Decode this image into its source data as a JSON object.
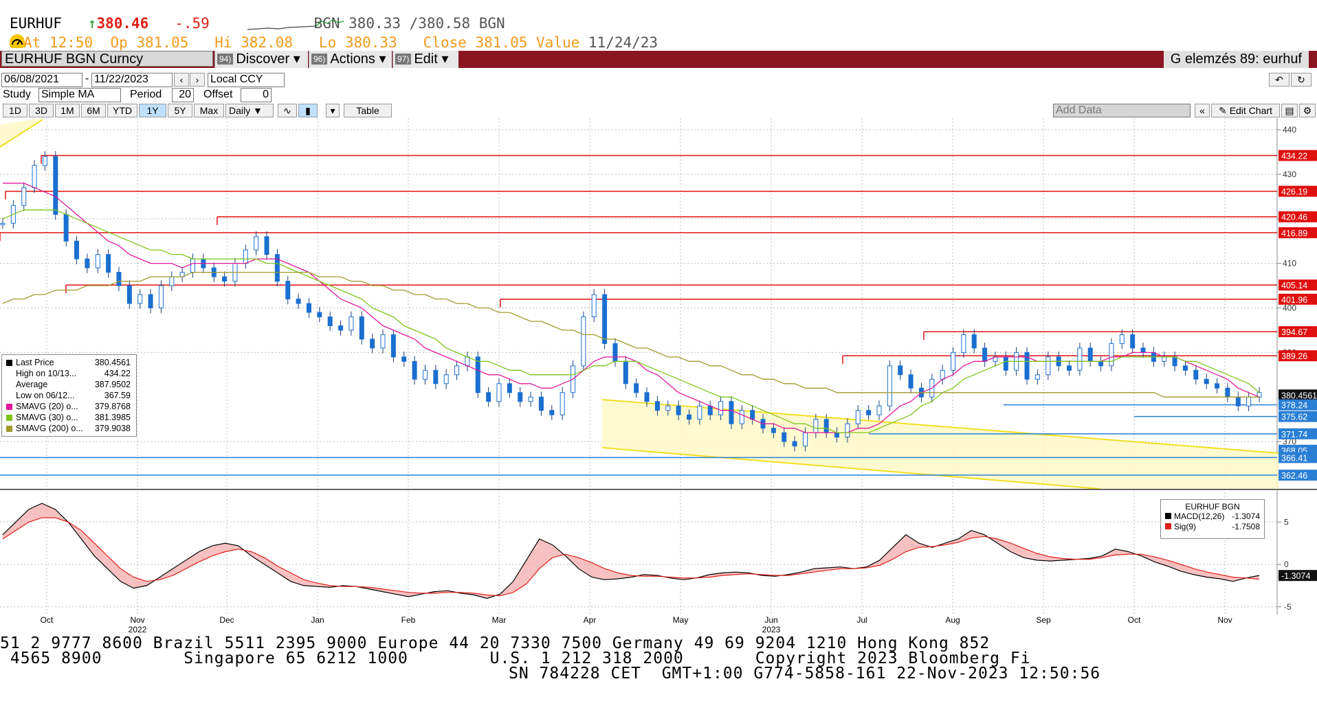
{
  "quote": {
    "ticker": "EURHUF",
    "arrow": "↑",
    "last": "380.46",
    "change": "-.59",
    "bid_ask": "BGN 380.33 /380.58 BGN",
    "at": "At 12:50",
    "open": "Op 381.05",
    "hi": "Hi 382.08",
    "lo": "Lo 380.33",
    "close_label": "Close 381.05",
    "value_label": "Value",
    "value_date": "11/24/23"
  },
  "toolbar": {
    "security": "EURHUF BGN Curncy",
    "discover_num": "94)",
    "discover": "Discover",
    "actions_num": "96)",
    "actions": "Actions",
    "edit_num": "97)",
    "edit": "Edit",
    "page_title": "G elemzés 89: eurhuf"
  },
  "controls": {
    "start_date": "06/08/2021",
    "end_date": "11/22/2023",
    "currency": "Local CCY",
    "study_label": "Study",
    "study_value": "Simple MA",
    "period_label": "Period",
    "period_value": "20",
    "offset_label": "Offset",
    "offset_value": "0",
    "ranges": [
      "1D",
      "3D",
      "1M",
      "6M",
      "YTD",
      "1Y",
      "5Y",
      "Max"
    ],
    "selected_range": "1Y",
    "frequency": "Daily",
    "table_label": "Table",
    "add_data": "Add Data",
    "edit_chart": "Edit Chart"
  },
  "legend": {
    "rows": [
      {
        "label": "Last Price",
        "value": "380.4561",
        "color": "#000000"
      },
      {
        "label": "High on 10/13...",
        "value": "434.22",
        "color": ""
      },
      {
        "label": "Average",
        "value": "387.9502",
        "color": ""
      },
      {
        "label": "Low on 06/12...",
        "value": "367.59",
        "color": ""
      },
      {
        "label": "SMAVG (20)  o...",
        "value": "379.8768",
        "color": "#e0189a"
      },
      {
        "label": "SMAVG (30)  o...",
        "value": "381.3985",
        "color": "#7fc41a"
      },
      {
        "label": "SMAVG (200)  o...",
        "value": "379.9038",
        "color": "#a09a2a"
      }
    ]
  },
  "macd_legend": {
    "title": "EURHUF BGN",
    "rows": [
      {
        "label": "MACD(12,26)",
        "value": "-1.3074",
        "color": "#000000"
      },
      {
        "label": "Sig(9)",
        "value": "-1.7508",
        "color": "#e0201a"
      }
    ]
  },
  "chart_data": {
    "type": "line",
    "title": "",
    "x_labels": [
      "Oct",
      "Nov",
      "Dec",
      "Jan",
      "Feb",
      "Mar",
      "Apr",
      "May",
      "Jun",
      "Jul",
      "Aug",
      "Sep",
      "Oct",
      "Nov"
    ],
    "year_labels": [
      "2022",
      "2023"
    ],
    "ylim": [
      360,
      442
    ],
    "y_ticks": [
      440,
      430,
      420,
      410,
      400,
      390,
      370
    ],
    "price_ticks": [
      440,
      430,
      420,
      410,
      400,
      390,
      370
    ],
    "price_labels": [
      "434.22",
      "426.19",
      "420.46",
      "416.89",
      "405.14",
      "401.96",
      "394.67",
      "389.26",
      "380.4561",
      "378.24",
      "375.62",
      "371.74",
      "368.05",
      "366.41",
      "362.46"
    ],
    "highlighted_label": "380.4561",
    "resistance_levels": [
      434.22,
      426.19,
      420.46,
      416.89,
      405.14,
      401.96,
      394.67,
      389.26
    ],
    "support_levels": [
      378.24,
      375.62,
      371.74,
      366.41,
      362.46
    ],
    "series": [
      {
        "values": [
          419,
          423,
          427,
          432,
          434,
          421,
          415,
          411,
          409,
          412,
          408,
          405,
          401,
          403,
          400,
          405,
          407,
          408,
          411,
          409,
          407,
          406,
          410,
          413,
          416,
          412,
          406,
          402,
          401,
          399,
          398,
          396,
          395,
          398,
          393,
          391,
          394,
          389,
          388,
          384,
          386,
          383,
          385,
          387,
          389,
          381,
          379,
          383,
          381,
          379,
          380,
          377,
          376,
          381,
          387,
          398,
          403,
          392,
          388,
          383,
          381,
          379,
          377,
          378,
          376,
          375,
          378,
          376,
          379,
          374,
          377,
          375,
          373,
          372,
          370,
          369,
          372,
          375,
          372,
          371,
          374,
          377,
          376,
          378,
          387,
          385,
          382,
          380,
          384,
          386,
          390,
          394,
          391,
          388,
          389,
          386,
          390,
          384,
          385,
          389,
          387,
          386,
          391,
          388,
          387,
          392,
          394,
          391,
          390,
          388,
          389,
          387,
          386,
          384,
          383,
          382,
          380,
          378,
          380,
          381
        ]
      },
      {
        "name": "SMAVG (20)",
        "values": [
          428,
          428,
          428,
          427,
          426,
          425,
          423,
          421,
          419,
          417,
          415,
          414,
          412,
          411,
          410,
          410,
          410,
          409,
          410,
          410,
          410,
          410,
          410,
          410,
          411,
          411,
          411,
          410,
          409,
          408,
          406,
          404,
          402,
          401,
          400,
          398,
          396,
          395,
          394,
          393,
          391,
          390,
          389,
          388,
          387,
          386,
          385,
          385,
          384,
          383,
          383,
          382,
          382,
          383,
          384,
          386,
          388,
          389,
          389,
          389,
          388,
          386,
          385,
          383,
          381,
          380,
          379,
          378,
          377,
          377,
          376,
          375,
          374,
          374,
          373,
          373,
          372,
          372,
          372,
          372,
          372,
          373,
          373,
          374,
          376,
          378,
          379,
          381,
          382,
          384,
          385,
          387,
          388,
          388,
          389,
          389,
          389,
          389,
          388,
          388,
          388,
          388,
          388,
          388,
          388,
          389,
          389,
          390,
          390,
          390,
          389,
          389,
          388,
          387,
          386,
          385,
          384,
          382,
          381,
          380
        ]
      },
      {
        "name": "SMAVG (30)",
        "values": [
          420,
          421,
          422,
          422,
          422,
          422,
          421,
          420,
          419,
          418,
          417,
          416,
          415,
          414,
          413,
          413,
          412,
          412,
          411,
          411,
          411,
          411,
          411,
          411,
          411,
          410,
          410,
          409,
          408,
          407,
          406,
          405,
          404,
          403,
          402,
          400,
          399,
          398,
          396,
          395,
          394,
          393,
          391,
          390,
          389,
          388,
          388,
          387,
          386,
          386,
          385,
          385,
          385,
          385,
          385,
          386,
          387,
          387,
          388,
          388,
          388,
          387,
          386,
          385,
          384,
          383,
          382,
          381,
          380,
          380,
          379,
          378,
          377,
          376,
          375,
          374,
          374,
          373,
          373,
          372,
          372,
          372,
          372,
          373,
          374,
          375,
          376,
          378,
          379,
          381,
          382,
          384,
          385,
          386,
          387,
          388,
          388,
          388,
          388,
          388,
          388,
          388,
          388,
          388,
          388,
          388,
          389,
          389,
          389,
          389,
          389,
          389,
          388,
          388,
          387,
          386,
          385,
          384,
          383,
          381
        ]
      },
      {
        "name": "SMAVG (200)",
        "values": [
          401,
          402,
          402,
          403,
          403,
          404,
          404,
          404,
          405,
          405,
          405,
          406,
          406,
          406,
          407,
          407,
          407,
          407,
          408,
          408,
          408,
          408,
          408,
          408,
          408,
          408,
          408,
          408,
          408,
          408,
          407,
          407,
          407,
          406,
          406,
          405,
          405,
          404,
          404,
          403,
          403,
          402,
          402,
          401,
          401,
          400,
          400,
          399,
          399,
          398,
          397,
          397,
          396,
          395,
          395,
          394,
          394,
          393,
          393,
          392,
          391,
          391,
          390,
          389,
          389,
          388,
          388,
          387,
          387,
          386,
          385,
          385,
          384,
          384,
          383,
          383,
          382,
          382,
          382,
          381,
          381,
          381,
          381,
          381,
          381,
          381,
          381,
          381,
          381,
          381,
          381,
          381,
          381,
          381,
          381,
          381,
          381,
          381,
          381,
          381,
          381,
          381,
          381,
          381,
          381,
          381,
          381,
          381,
          381,
          381,
          380,
          380,
          380,
          380,
          380,
          380,
          380,
          380,
          380,
          380
        ]
      }
    ],
    "macd": {
      "ylim": [
        -5.5,
        8.5
      ],
      "ticks": [
        5,
        0,
        -5
      ],
      "current_label": "-1.3074",
      "series": [
        {
          "name": "MACD(12,26)",
          "values": [
            3.5,
            5,
            6.5,
            7.2,
            6.5,
            5,
            3,
            1,
            -0.5,
            -2,
            -2.8,
            -2.5,
            -1.5,
            -0.5,
            0.5,
            1.5,
            2.2,
            2.5,
            2.2,
            1,
            0,
            -1,
            -2,
            -2.5,
            -2.6,
            -2.7,
            -2.5,
            -2.6,
            -2.9,
            -3.2,
            -3.5,
            -3.8,
            -3.5,
            -3.2,
            -3.1,
            -3.4,
            -3.6,
            -4,
            -3.5,
            -2,
            0.5,
            3,
            2.3,
            1,
            -0.5,
            -1.5,
            -1.8,
            -1.7,
            -1.5,
            -1.2,
            -1.3,
            -1.6,
            -1.8,
            -1.6,
            -1.2,
            -1,
            -0.9,
            -1,
            -1.3,
            -1.4,
            -1.2,
            -0.9,
            -0.5,
            -0.4,
            -0.3,
            -0.5,
            -0.3,
            0.5,
            2,
            3.5,
            2.5,
            2,
            2.5,
            3,
            4,
            3.5,
            2.5,
            1.5,
            0.8,
            0.5,
            0.4,
            0.5,
            0.6,
            0.7,
            1,
            1.8,
            1.5,
            1,
            0.3,
            -0.2,
            -0.8,
            -1.2,
            -1.5,
            -1.7,
            -2,
            -1.6,
            -1.3
          ]
        },
        {
          "name": "Sig(9)",
          "values": [
            3,
            4,
            5,
            5.5,
            5.5,
            5,
            4,
            2.5,
            1,
            -0.5,
            -1.5,
            -2,
            -1.8,
            -1.3,
            -0.5,
            0.3,
            1,
            1.5,
            1.8,
            1.5,
            0.8,
            -0.2,
            -1,
            -1.8,
            -2.2,
            -2.5,
            -2.6,
            -2.6,
            -2.7,
            -2.9,
            -3.1,
            -3.3,
            -3.4,
            -3.4,
            -3.3,
            -3.3,
            -3.4,
            -3.6,
            -3.7,
            -3.3,
            -2.3,
            -0.5,
            0.8,
            1.2,
            0.8,
            0.2,
            -0.5,
            -1,
            -1.3,
            -1.4,
            -1.4,
            -1.5,
            -1.6,
            -1.6,
            -1.5,
            -1.3,
            -1.2,
            -1.1,
            -1.2,
            -1.3,
            -1.3,
            -1.1,
            -0.9,
            -0.7,
            -0.5,
            -0.5,
            -0.4,
            -0.1,
            0.6,
            1.5,
            2,
            2.1,
            2.3,
            2.6,
            3.1,
            3.3,
            3,
            2.5,
            1.9,
            1.3,
            0.9,
            0.7,
            0.6,
            0.6,
            0.8,
            1.1,
            1.2,
            1.2,
            0.9,
            0.5,
            0,
            -0.5,
            -0.9,
            -1.2,
            -1.5,
            -1.6,
            -1.75
          ]
        }
      ]
    }
  },
  "footer": {
    "line1": "51 2 9777 8600 Brazil 5511 2395 9000 Europe 44 20 7330 7500 Germany 49 69 9204 1210 Hong Kong 852",
    "line2": " 4565 8900        Singapore 65 6212 1000        U.S. 1 212 318 2000       Copyright 2023 Bloomberg Fi",
    "line3": "SN 784228 CET  GMT+1:00 G774-5858-161 22-Nov-2023 12:50:56"
  }
}
